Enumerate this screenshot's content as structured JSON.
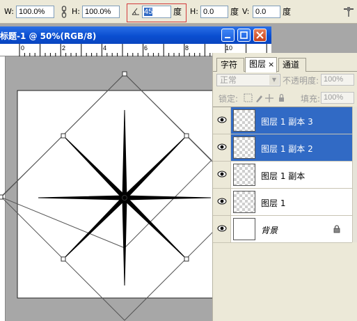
{
  "options_bar": {
    "w_label": "W:",
    "w_value": "100.0%",
    "h_label": "H:",
    "h_value": "100.0%",
    "angle_value": "45",
    "angle_unit": "度",
    "skew_h_label": "H:",
    "skew_h_value": "0.0",
    "skew_h_unit": "度",
    "skew_v_label": "V:",
    "skew_v_value": "0.0",
    "skew_v_unit": "度"
  },
  "document": {
    "title": "标题-1 @ 50%(RGB/8)",
    "ruler_labels": [
      "0",
      "2",
      "4",
      "6",
      "8",
      "10"
    ]
  },
  "layers_panel": {
    "tabs": [
      {
        "label": "字符"
      },
      {
        "label": "图层"
      },
      {
        "label": "通道"
      }
    ],
    "close_glyph": "×",
    "blend_mode": "正常",
    "opacity_label": "不透明度:",
    "opacity_value": "100%",
    "lock_label": "锁定:",
    "fill_label": "填充:",
    "fill_value": "100%",
    "layers": [
      {
        "name": "图层 1 副本 3",
        "selected": true
      },
      {
        "name": "图层 1 副本 2",
        "selected": true
      },
      {
        "name": "图层 1 副本",
        "selected": false
      },
      {
        "name": "图层 1",
        "selected": false
      },
      {
        "name": "背景",
        "selected": false
      }
    ]
  },
  "colors": {
    "selection": "#316ac5",
    "titlebar": "#0a4ed0",
    "highlight_box": "#d23a3a"
  }
}
